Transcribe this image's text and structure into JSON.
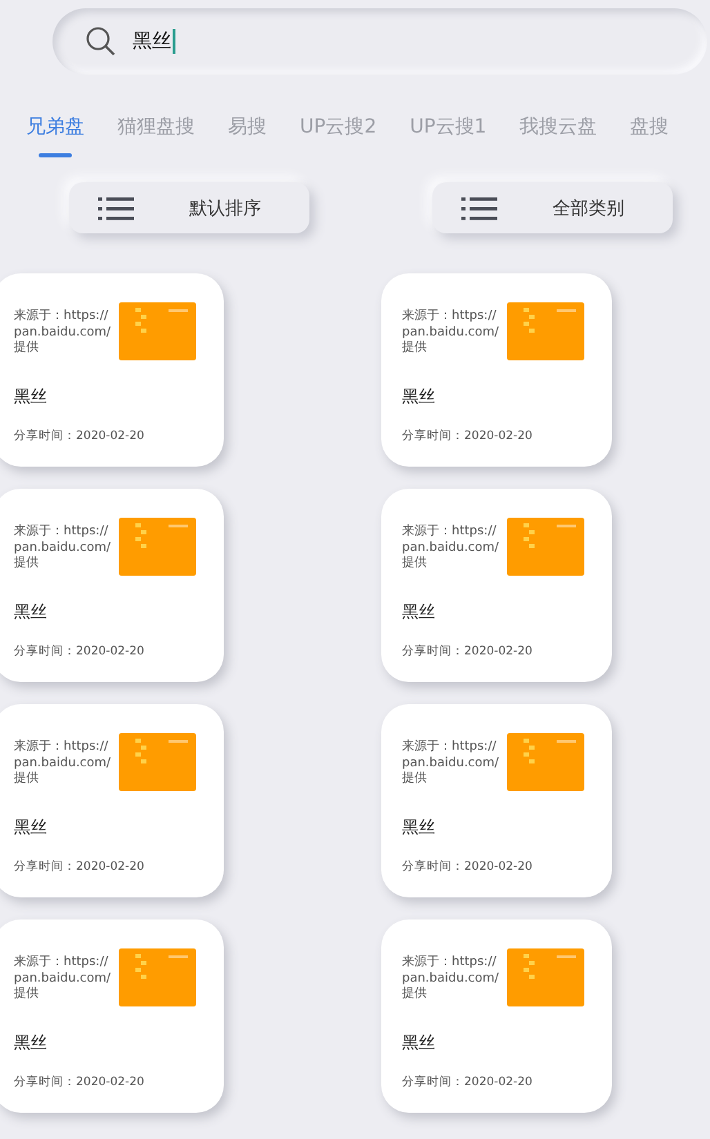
{
  "search": {
    "value": "黑丝"
  },
  "tabs": [
    {
      "label": "兄弟盘",
      "selected": true
    },
    {
      "label": "猫狸盘搜",
      "selected": false
    },
    {
      "label": "易搜",
      "selected": false
    },
    {
      "label": "UP云搜2",
      "selected": false
    },
    {
      "label": "UP云搜1",
      "selected": false
    },
    {
      "label": "我搜云盘",
      "selected": false
    },
    {
      "label": "盘搜",
      "selected": false
    }
  ],
  "filters": [
    {
      "label": "默认排序"
    },
    {
      "label": "全部类别"
    }
  ],
  "results": [
    {
      "source": "来源于：https://pan.baidu.com/提供",
      "title": "黑丝",
      "share_time": "分享时间：2020-02-20"
    },
    {
      "source": "来源于：https://pan.baidu.com/提供",
      "title": "黑丝",
      "share_time": "分享时间：2020-02-20"
    },
    {
      "source": "来源于：https://pan.baidu.com/提供",
      "title": "黑丝",
      "share_time": "分享时间：2020-02-20"
    },
    {
      "source": "来源于：https://pan.baidu.com/提供",
      "title": "黑丝",
      "share_time": "分享时间：2020-02-20"
    },
    {
      "source": "来源于：https://pan.baidu.com/提供",
      "title": "黑丝",
      "share_time": "分享时间：2020-02-20"
    },
    {
      "source": "来源于：https://pan.baidu.com/提供",
      "title": "黑丝",
      "share_time": "分享时间：2020-02-20"
    },
    {
      "source": "来源于：https://pan.baidu.com/提供",
      "title": "黑丝",
      "share_time": "分享时间：2020-02-20"
    },
    {
      "source": "来源于：https://pan.baidu.com/提供",
      "title": "黑丝",
      "share_time": "分享时间：2020-02-20"
    }
  ]
}
